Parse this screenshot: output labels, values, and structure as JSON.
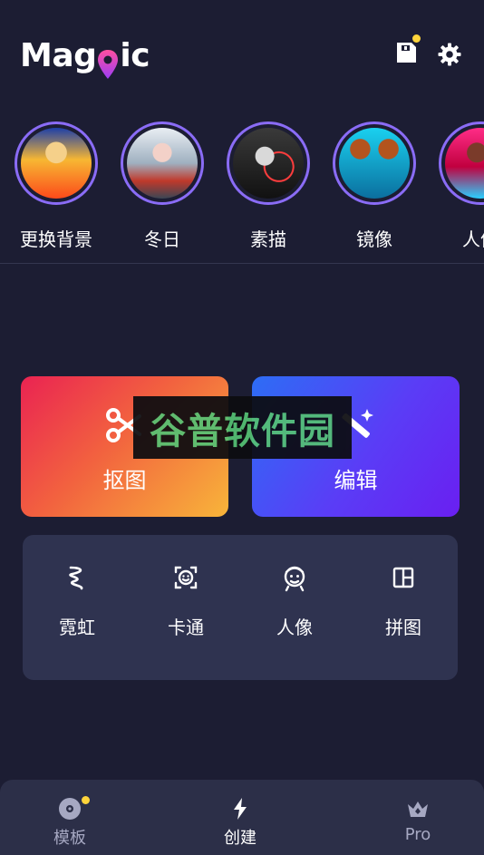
{
  "header": {
    "logo_text_left": "Mag",
    "logo_text_right": "ic",
    "icons": [
      "save-icon",
      "settings-icon"
    ],
    "notification_dot_color": "#ffd43b"
  },
  "stories": [
    {
      "label": "更换背景",
      "colors": [
        "#f7b733",
        "#fc4a1a"
      ]
    },
    {
      "label": "冬日",
      "colors": [
        "#c9d6df",
        "#5f6f80"
      ]
    },
    {
      "label": "素描",
      "colors": [
        "#2b2b2b",
        "#ff3d3d"
      ]
    },
    {
      "label": "镜像",
      "colors": [
        "#1ad1f0",
        "#b3541e"
      ]
    },
    {
      "label": "人像",
      "colors": [
        "#ff2d87",
        "#2ad0ff"
      ]
    }
  ],
  "cards": {
    "cutout": {
      "label": "抠图",
      "icon": "scissors-icon"
    },
    "edit": {
      "label": "编辑",
      "icon": "magic-wand-icon"
    }
  },
  "watermark": {
    "text": "谷普软件园"
  },
  "tools": [
    {
      "label": "霓虹",
      "icon": "neon-icon"
    },
    {
      "label": "卡通",
      "icon": "cartoon-face-icon"
    },
    {
      "label": "人像",
      "icon": "portrait-icon"
    },
    {
      "label": "拼图",
      "icon": "collage-icon"
    }
  ],
  "bottom_nav": {
    "templates": {
      "label": "模板",
      "color": "#a6a8c2"
    },
    "create": {
      "label": "创建",
      "color": "#ffffff"
    },
    "pro": {
      "label": "Pro",
      "color": "#a6a8c2"
    }
  },
  "colors": {
    "background": "#1c1d33",
    "accent_ring": "#8a6cf6",
    "panel": "#2f3350",
    "nav": "#2c2f48"
  }
}
